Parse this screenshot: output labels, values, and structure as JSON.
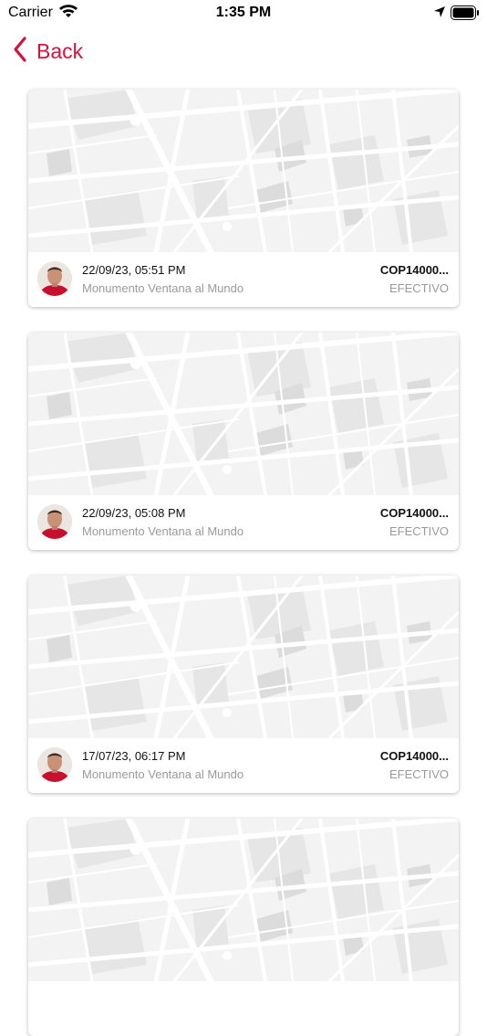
{
  "status_bar": {
    "carrier": "Carrier",
    "time": "1:35 PM",
    "icons": [
      "wifi-icon",
      "location-arrow-icon",
      "battery-icon"
    ]
  },
  "nav": {
    "back_label": "Back"
  },
  "colors": {
    "accent": "#d4123c",
    "map_bg": "#f4f4f4",
    "secondary_text": "#9a9a9a"
  },
  "trips": [
    {
      "datetime": "22/09/23, 05:51 PM",
      "place": "Monumento Ventana al Mundo",
      "amount": "COP14000...",
      "payment": "EFECTIVO"
    },
    {
      "datetime": "22/09/23, 05:08 PM",
      "place": "Monumento Ventana al Mundo",
      "amount": "COP14000...",
      "payment": "EFECTIVO"
    },
    {
      "datetime": "17/07/23, 06:17 PM",
      "place": "Monumento Ventana al Mundo",
      "amount": "COP14000...",
      "payment": "EFECTIVO"
    }
  ]
}
